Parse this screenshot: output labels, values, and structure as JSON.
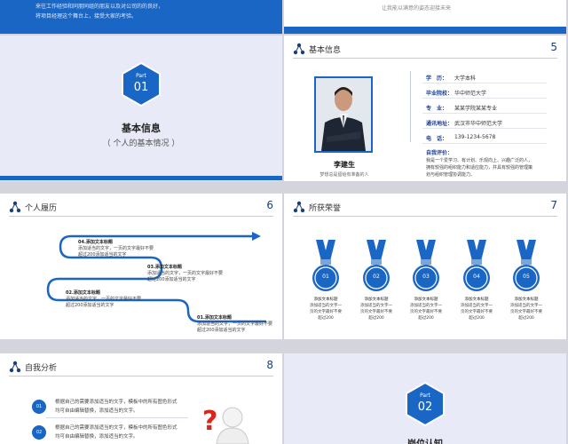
{
  "top_left": {
    "line1": "来往工作经验和同朋同组的朋友以及对公司的的良好，",
    "line2": "将项目经理这个舞台上，接受大家的考验。"
  },
  "top_right": {
    "line1": "让我能以满意的姿态迎接未来",
    "line2": ""
  },
  "part1": {
    "word": "Part",
    "num": "01",
    "title": "基本信息",
    "subtitle": "（ 个人的基本情况 ）"
  },
  "basic": {
    "title": "基本信息",
    "page": "5",
    "name": "李建生",
    "motto": "梦想总是留给有准备的人",
    "rows": [
      {
        "k": "学　历：",
        "v": "大学本科"
      },
      {
        "k": "毕业院校：",
        "v": "华中师范大学"
      },
      {
        "k": "专　业：",
        "v": "某某学院某某专业"
      },
      {
        "k": "通讯地址：",
        "v": "武汉市华中师范大学"
      },
      {
        "k": "电　话：",
        "v": "139-1234-5678"
      }
    ],
    "eval_label": "自我评价：",
    "eval_text1": "我是一个爱学习、有计划、乐观向上、兴趣广泛的人，",
    "eval_text2": "拥有较强的组织能力和适应能力，并具有较强的管理策",
    "eval_text3": "划与组织管理协调能力。"
  },
  "history": {
    "title": "个人履历",
    "page": "6",
    "items": [
      {
        "t": "04.添加文本标题",
        "d1": "添加适当的文字，一页的文字最好不要",
        "d2": "超过200添加适当的文字"
      },
      {
        "t": "03.添加文本标题",
        "d1": "添加适当的文字，一页的文字最好不要",
        "d2": "超过200添加适当的文字"
      },
      {
        "t": "02.添加文本标题",
        "d1": "添加适当的文字，一页的文字最好不要",
        "d2": "超过200添加适当的文字"
      },
      {
        "t": "01.添加文本标题",
        "d1": "添加适当的文字，一页的文字最好不要",
        "d2": "超过200添加适当的文字"
      }
    ]
  },
  "honors": {
    "title": "所获荣誉",
    "page": "7",
    "items": [
      {
        "n": "01",
        "t": "添加文本标题",
        "d1": "添加适当的文字一",
        "d2": "页的文字最好不要",
        "d3": "超过200"
      },
      {
        "n": "02",
        "t": "添加文本标题",
        "d1": "添加适当的文字一",
        "d2": "页的文字最好不要",
        "d3": "超过200"
      },
      {
        "n": "03",
        "t": "添加文本标题",
        "d1": "添加适当的文字一",
        "d2": "页的文字最好不要",
        "d3": "超过200"
      },
      {
        "n": "04",
        "t": "添加文本标题",
        "d1": "添加适当的文字一",
        "d2": "页的文字最好不要",
        "d3": "超过200"
      },
      {
        "n": "05",
        "t": "添加文本标题",
        "d1": "添加适当的文字一",
        "d2": "页的文字最好不要",
        "d3": "超过200"
      }
    ]
  },
  "self": {
    "title": "自我分析",
    "page": "8",
    "items": [
      {
        "n": "01",
        "l1": "根据自己的需要添加适当的文字，模板中的所有图色形式",
        "l2": "均可自由编辑替换，添加适当的文字。"
      },
      {
        "n": "02",
        "l1": "根据自己的需要添加适当的文字，模板中的所有图色形式",
        "l2": "均可自由编辑替换，添加适当的文字。"
      }
    ]
  },
  "part2": {
    "word": "Part",
    "num": "02",
    "title": "岗位认知"
  }
}
